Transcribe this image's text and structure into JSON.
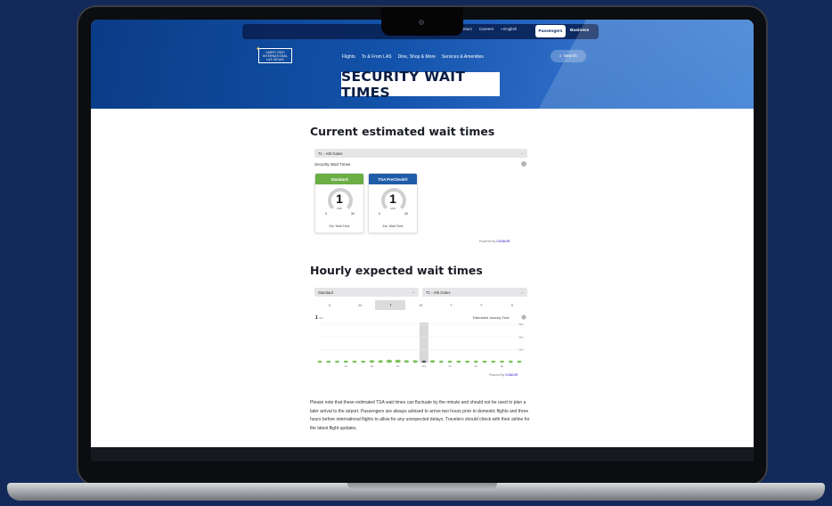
{
  "topbar": {
    "links": [
      "Contact",
      "Careers",
      "English"
    ],
    "tabs": [
      {
        "label": "Passengers",
        "active": true
      },
      {
        "label": "Business",
        "active": false
      }
    ]
  },
  "logo": {
    "lines": [
      "HARRY REID",
      "INTERNATIONAL",
      "LAS VEGAS"
    ]
  },
  "nav": {
    "items": [
      "Flights",
      "To & From LAS",
      "Dine, Shop & More",
      "Services & Amenities"
    ],
    "search_label": "Search"
  },
  "hero": {
    "title": "SECURITY WAIT TIMES"
  },
  "current": {
    "heading": "Current estimated wait times",
    "location_select": "T1 - A/B Gates",
    "section_label": "Security Wait Times",
    "cards": [
      {
        "title": "Standard",
        "color": "#6aae45",
        "value": "1",
        "unit": "MIN",
        "min": "0",
        "max": "30",
        "footer": "Est. Wait Time"
      },
      {
        "title": "TSA PreCheck®",
        "color": "#1f5da8",
        "value": "1",
        "unit": "MIN",
        "min": "0",
        "max": "30",
        "footer": "Est. Wait Time"
      }
    ],
    "powered_by": "Powered By",
    "powered_brand": "CONDOR"
  },
  "hourly": {
    "heading": "Hourly expected wait times",
    "lane_select": "Standard",
    "location_select": "T1 - A/B Gates",
    "days": [
      "S",
      "M",
      "T",
      "W",
      "T",
      "F",
      "S"
    ],
    "active_day_index": 2,
    "current_value": "1",
    "current_unit": "min",
    "journey_label": "Estimated Journey Time",
    "powered_by": "Powered By",
    "powered_brand": "CONDOR"
  },
  "chart_data": {
    "type": "scatter",
    "y_ticks": [
      "30m",
      "20m",
      "10m"
    ],
    "x_ticks": [
      "3a",
      "6a",
      "9a",
      "12p",
      "3p",
      "6p",
      "9p"
    ],
    "ylim": [
      0,
      30
    ],
    "highlight_hour": 12,
    "hours": [
      0,
      1,
      2,
      3,
      4,
      5,
      6,
      7,
      8,
      9,
      10,
      11,
      12,
      13,
      14,
      15,
      16,
      17,
      18,
      19,
      20,
      21,
      22,
      23
    ],
    "values": [
      1,
      1,
      1,
      1,
      1,
      1,
      2,
      2,
      3,
      3,
      2,
      2,
      1,
      2,
      1,
      1,
      1,
      1,
      1,
      1,
      1,
      1,
      1,
      1
    ]
  },
  "note": {
    "text": "Please note that these estimated TSA wait times can fluctuate by the minute and should not be used to plan a later arrival to the airport. Passengers are always advised to arrive two hours prior to domestic flights and three hours before international flights to allow for any unexpected delays. Travelers should check with their airline for the latest flight updates."
  },
  "colors": {
    "brand_blue": "#0a3c86",
    "standard_green": "#6aae45",
    "precheck_blue": "#1f5da8",
    "background_navy": "#12295a"
  }
}
